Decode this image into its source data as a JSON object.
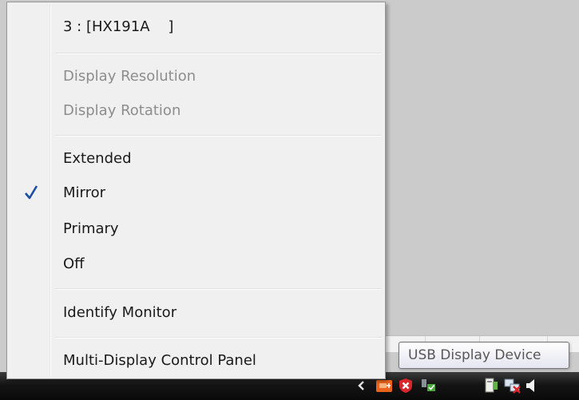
{
  "menu": {
    "header": "3 : [HX191A    ]",
    "display_resolution": "Display Resolution",
    "display_rotation": "Display Rotation",
    "extended": "Extended",
    "mirror": "Mirror",
    "primary": "Primary",
    "off": "Off",
    "identify_monitor": "Identify Monitor",
    "multi_display_control_panel": "Multi-Display Control Panel",
    "checked_item": "Mirror"
  },
  "tooltip": {
    "text": "USB Display Device"
  },
  "tray": {
    "icons": [
      "chevron-left-icon",
      "usb-device-icon",
      "security-alert-icon",
      "network-icon",
      "device-icon",
      "network-disconnected-icon",
      "volume-icon"
    ]
  },
  "colors": {
    "menu_bg": "#f0f0f0",
    "check_color": "#1c4ea0",
    "disabled_text": "#8d8d8d",
    "taskbar": "#141414"
  }
}
